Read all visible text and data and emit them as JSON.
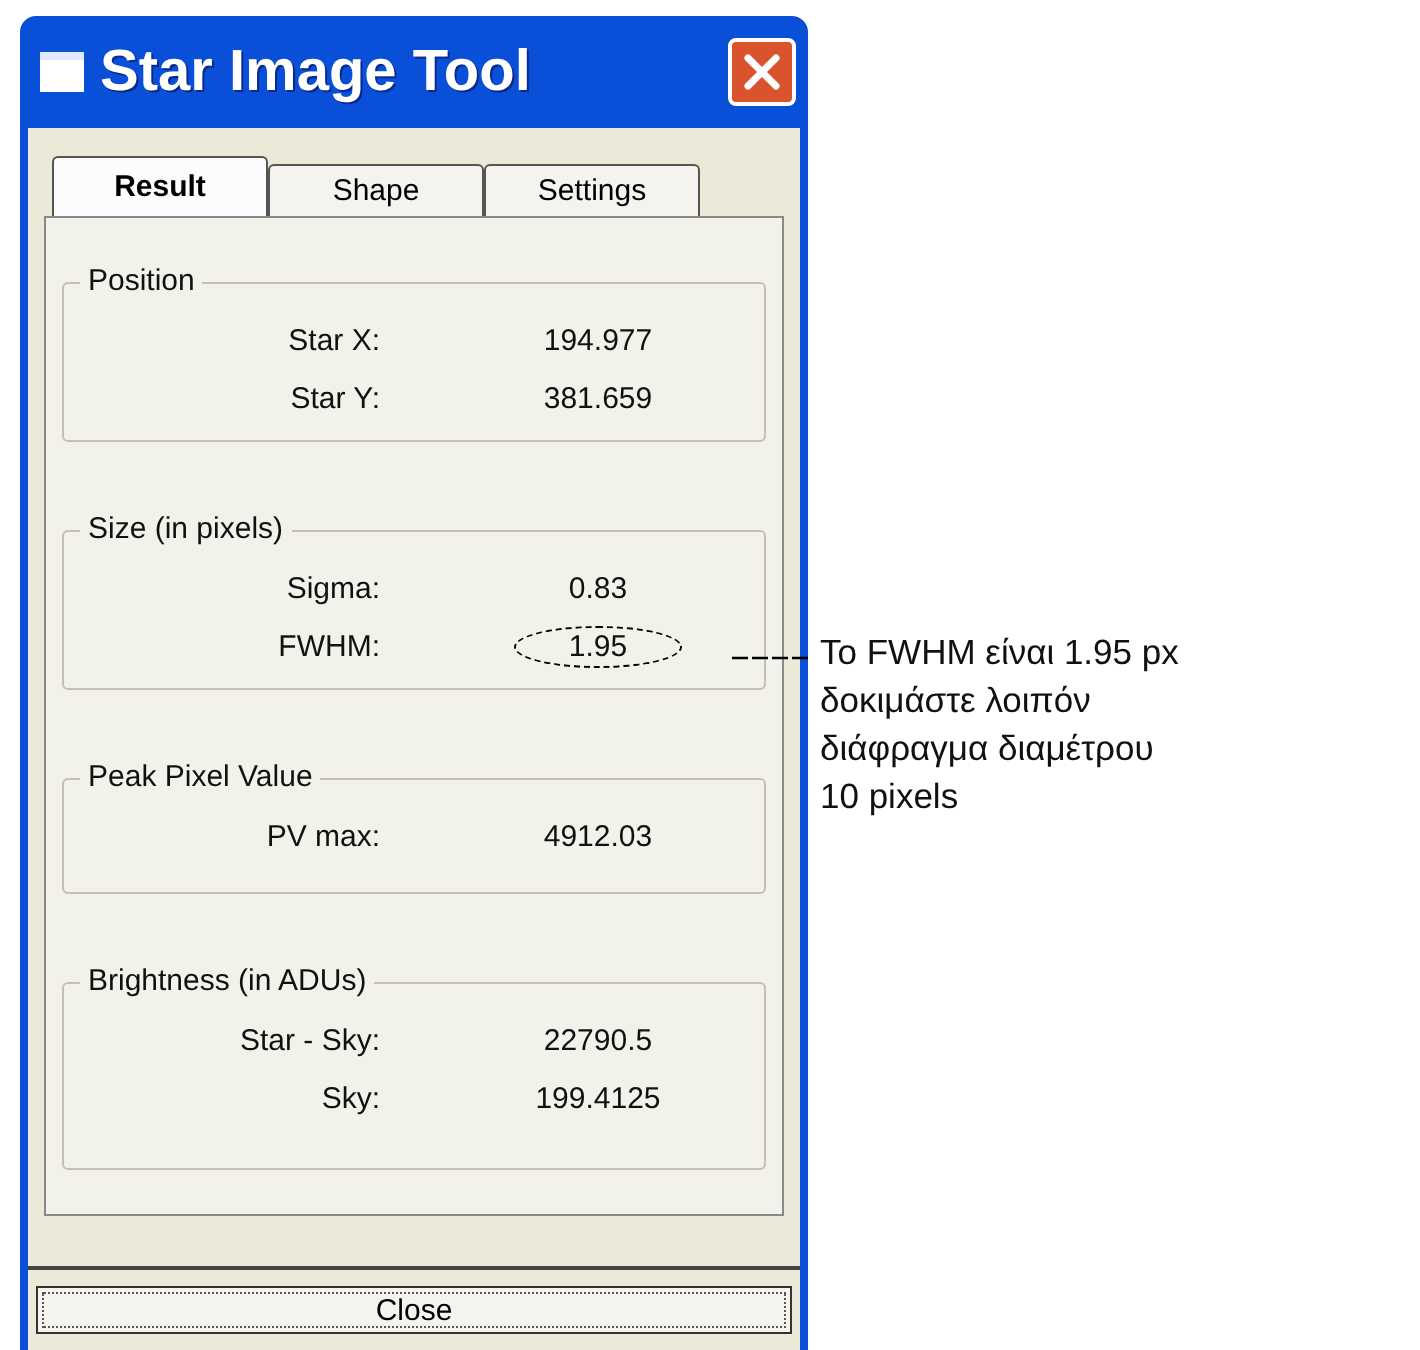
{
  "window": {
    "title": "Star Image Tool"
  },
  "tabs": [
    {
      "label": "Result",
      "selected": true
    },
    {
      "label": "Shape",
      "selected": false
    },
    {
      "label": "Settings",
      "selected": false
    }
  ],
  "groups": [
    {
      "title": "Position",
      "fields": [
        {
          "label": "Star X:",
          "value": "194.977",
          "circled": false
        },
        {
          "label": "Star Y:",
          "value": "381.659",
          "circled": false
        }
      ]
    },
    {
      "title": "Size (in pixels)",
      "fields": [
        {
          "label": "Sigma:",
          "value": "0.83",
          "circled": false
        },
        {
          "label": "FWHM:",
          "value": "1.95",
          "circled": true
        }
      ]
    },
    {
      "title": "Peak Pixel Value",
      "fields": [
        {
          "label": "PV max:",
          "value": "4912.03",
          "circled": false
        }
      ]
    },
    {
      "title": "Brightness (in ADUs)",
      "fields": [
        {
          "label": "Star - Sky:",
          "value": "22790.5",
          "circled": false
        },
        {
          "label": "Sky:",
          "value": "199.4125",
          "circled": false
        }
      ]
    }
  ],
  "close_button": {
    "label": "Close"
  },
  "annotation": {
    "lines": [
      "Το FWHM είναι 1.95 px",
      "δοκιμάστε λοιπόν",
      "διάφραγμα διαμέτρου",
      "10 pixels"
    ]
  }
}
